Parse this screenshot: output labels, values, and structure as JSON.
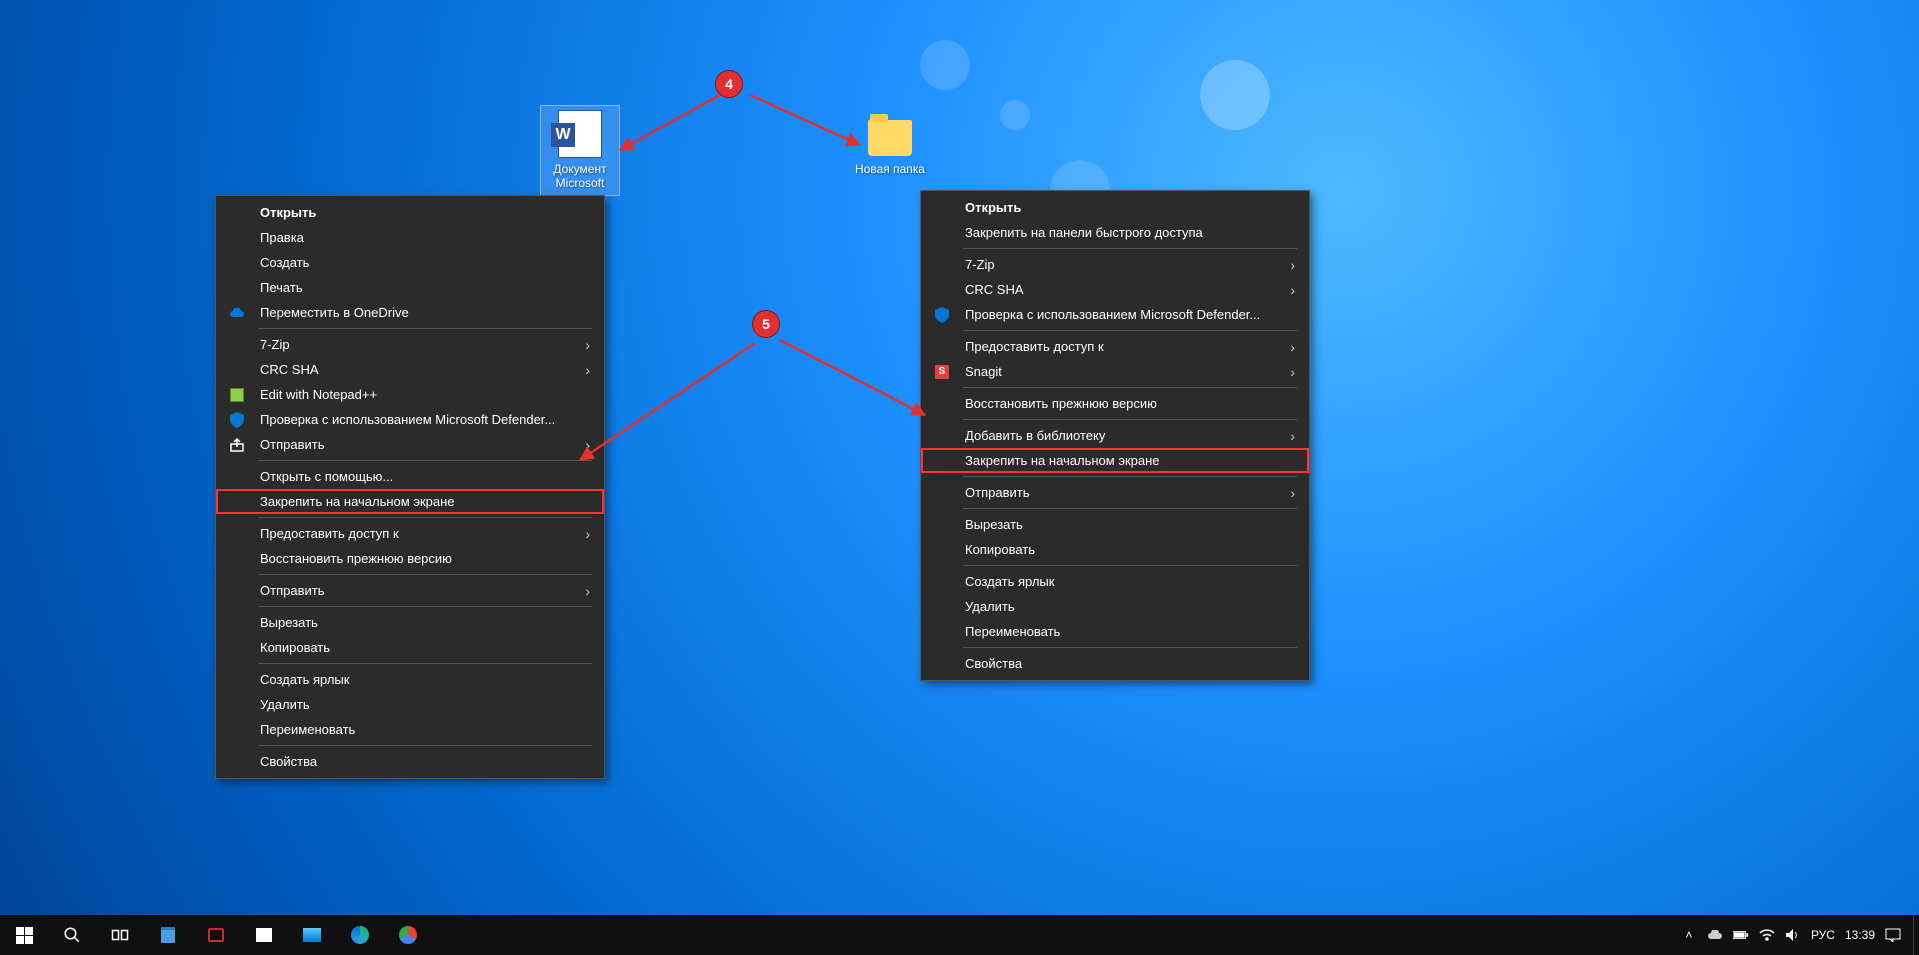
{
  "desktop_icons": {
    "word": {
      "label": "Документ Microsoft"
    },
    "folder": {
      "label": "Новая папка"
    }
  },
  "callouts": {
    "c4": "4",
    "c5": "5"
  },
  "menu_left": [
    {
      "label": "Открыть",
      "bold": true
    },
    {
      "label": "Правка"
    },
    {
      "label": "Создать"
    },
    {
      "label": "Печать"
    },
    {
      "label": "Переместить в OneDrive",
      "icon": "onedrive"
    },
    {
      "sep": true
    },
    {
      "label": "7-Zip",
      "submenu": true
    },
    {
      "label": "CRC SHA",
      "submenu": true
    },
    {
      "label": "Edit with Notepad++",
      "icon": "notepad"
    },
    {
      "label": "Проверка с использованием Microsoft Defender...",
      "icon": "defender"
    },
    {
      "label": "Отправить",
      "icon": "share",
      "submenu": true
    },
    {
      "sep": true
    },
    {
      "label": "Открыть с помощью..."
    },
    {
      "label": "Закрепить на начальном экране",
      "highlighted": true
    },
    {
      "sep": true
    },
    {
      "label": "Предоставить доступ к",
      "submenu": true
    },
    {
      "label": "Восстановить прежнюю версию"
    },
    {
      "sep": true
    },
    {
      "label": "Отправить",
      "submenu": true
    },
    {
      "sep": true
    },
    {
      "label": "Вырезать"
    },
    {
      "label": "Копировать"
    },
    {
      "sep": true
    },
    {
      "label": "Создать ярлык"
    },
    {
      "label": "Удалить"
    },
    {
      "label": "Переименовать"
    },
    {
      "sep": true
    },
    {
      "label": "Свойства"
    }
  ],
  "menu_right": [
    {
      "label": "Открыть",
      "bold": true
    },
    {
      "label": "Закрепить на панели быстрого доступа"
    },
    {
      "sep": true
    },
    {
      "label": "7-Zip",
      "submenu": true
    },
    {
      "label": "CRC SHA",
      "submenu": true
    },
    {
      "label": "Проверка с использованием Microsoft Defender...",
      "icon": "defender"
    },
    {
      "sep": true
    },
    {
      "label": "Предоставить доступ к",
      "submenu": true
    },
    {
      "label": "Snagit",
      "icon": "snagit",
      "submenu": true
    },
    {
      "sep": true
    },
    {
      "label": "Восстановить прежнюю версию"
    },
    {
      "sep": true
    },
    {
      "label": "Добавить в библиотеку",
      "submenu": true
    },
    {
      "label": "Закрепить на начальном экране",
      "highlighted": true
    },
    {
      "sep": true
    },
    {
      "label": "Отправить",
      "submenu": true
    },
    {
      "sep": true
    },
    {
      "label": "Вырезать"
    },
    {
      "label": "Копировать"
    },
    {
      "sep": true
    },
    {
      "label": "Создать ярлык"
    },
    {
      "label": "Удалить"
    },
    {
      "label": "Переименовать"
    },
    {
      "sep": true
    },
    {
      "label": "Свойства"
    }
  ],
  "taskbar": {
    "lang": "РУС",
    "time": "13:39"
  }
}
